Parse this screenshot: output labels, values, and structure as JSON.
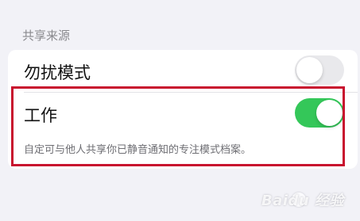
{
  "section": {
    "header": "共享来源"
  },
  "rows": [
    {
      "label": "勿扰模式",
      "toggle": "off"
    },
    {
      "label": "工作",
      "toggle": "on"
    }
  ],
  "footer": "自定可与他人共享你已静音通知的专注模式档案。",
  "watermark": "Baidu 经验",
  "colors": {
    "background": "#f2f2f7",
    "toggle_on": "#34c759",
    "toggle_off": "#e9e9ec",
    "highlight": "#c8102e"
  }
}
